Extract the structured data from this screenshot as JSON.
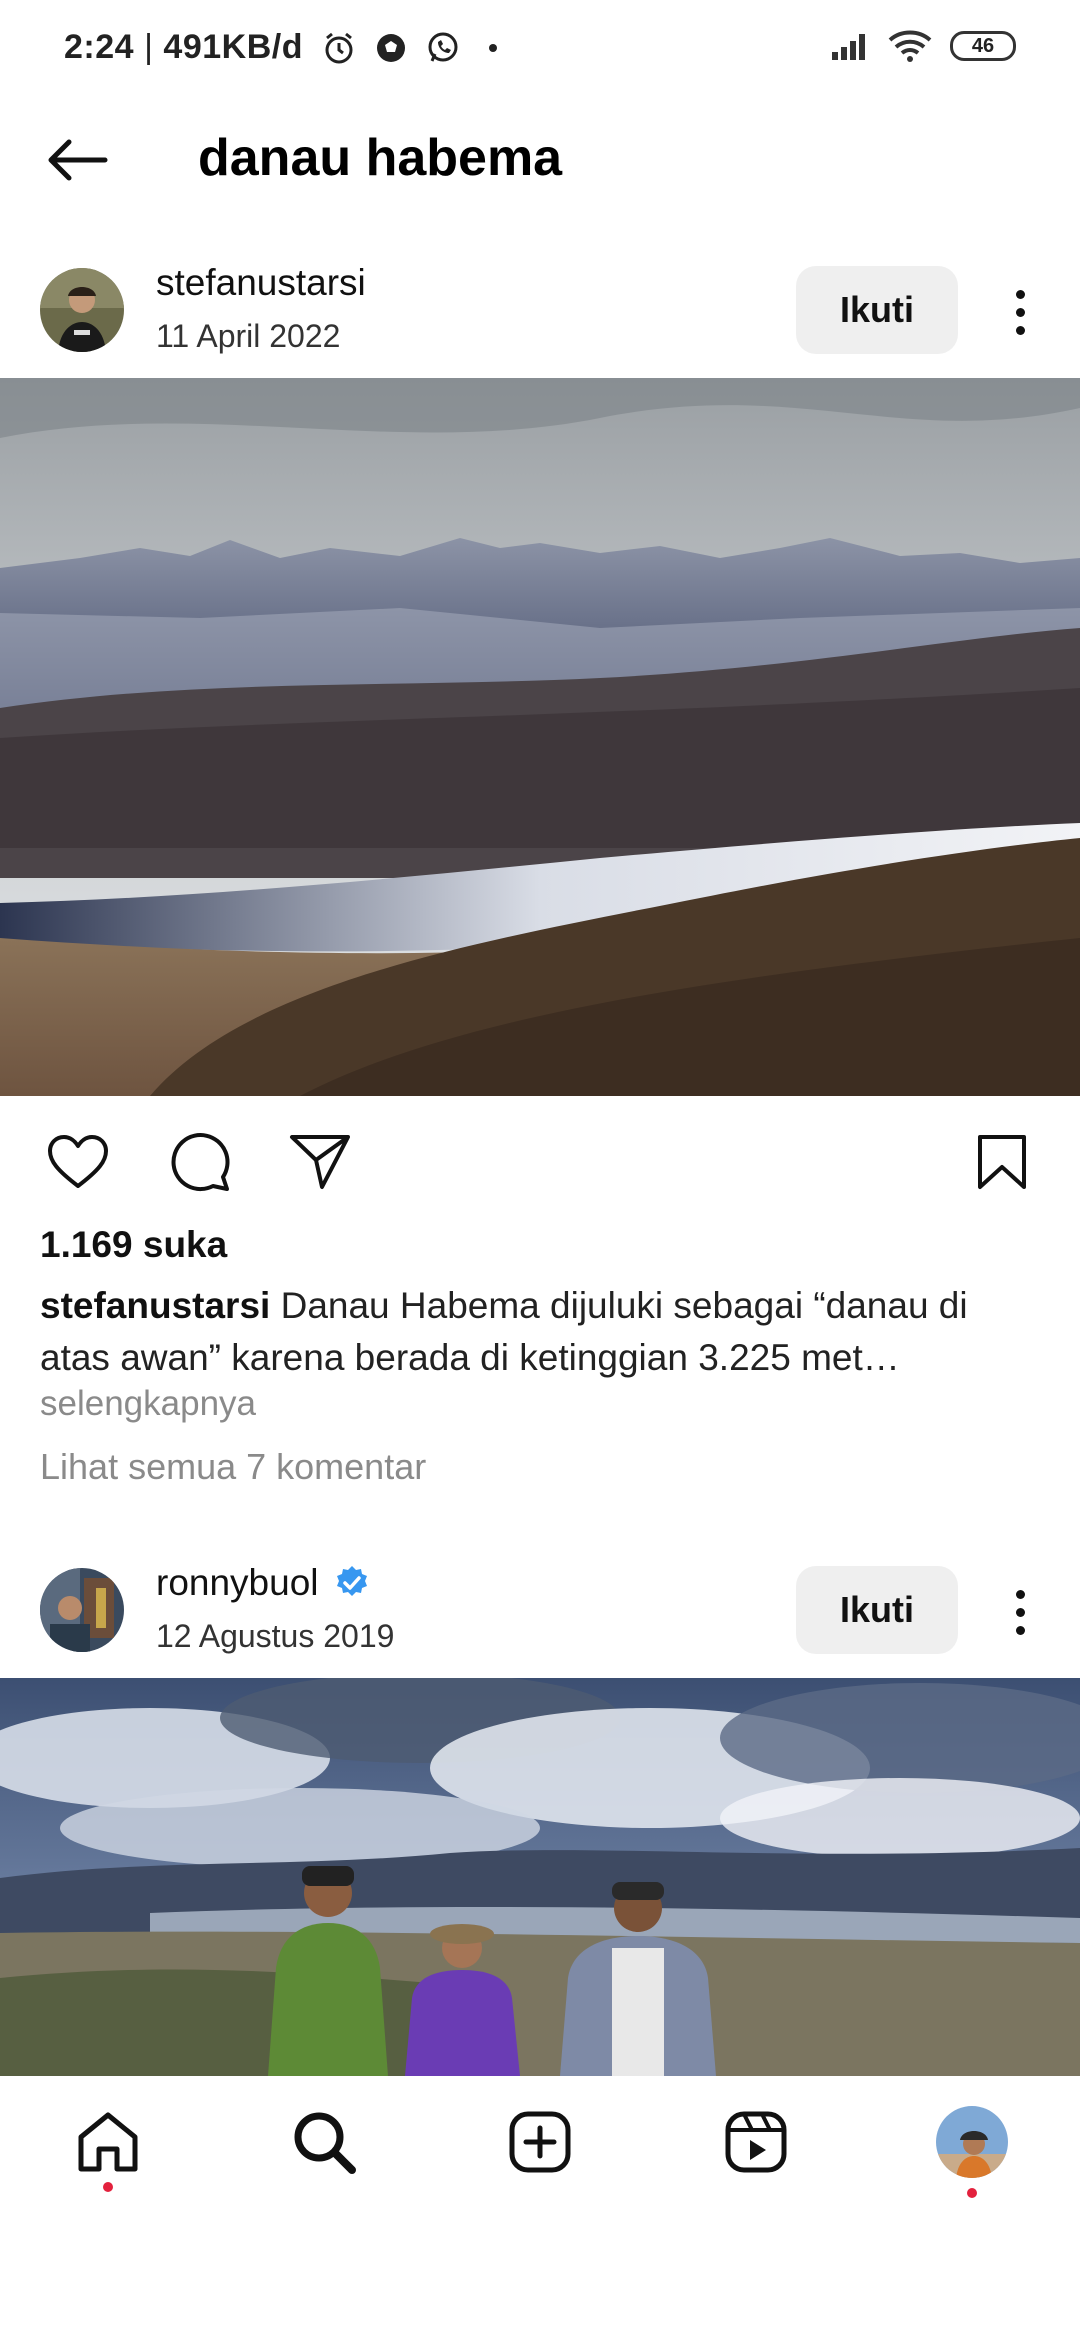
{
  "status_bar": {
    "time": "2:24",
    "separator": "|",
    "network_speed": "491KB/d",
    "battery": "46",
    "icons": [
      "alarm-icon",
      "soccer-ball-icon",
      "whatsapp-icon",
      "signal-icon",
      "wifi-icon",
      "battery-icon"
    ]
  },
  "header": {
    "title": "danau habema",
    "back_icon": "arrow-left-icon"
  },
  "posts": [
    {
      "username": "stefanustarsi",
      "date": "11 April 2022",
      "follow_label": "Ikuti",
      "verified": false,
      "likes": "1.169 suka",
      "caption_user": "stefanustarsi",
      "caption_text": " Danau Habema dijuluki sebagai “danau di atas awan” karena berada di ketinggian 3.225 met…",
      "more_label": "selengkapnya",
      "comments_label": "Lihat semua 7 komentar"
    },
    {
      "username": "ronnybuol",
      "date": "12 Agustus 2019",
      "follow_label": "Ikuti",
      "verified": true
    }
  ],
  "actions": [
    "heart-icon",
    "comment-icon",
    "share-icon",
    "bookmark-icon"
  ],
  "bottom_nav": [
    "home-icon",
    "search-icon",
    "create-icon",
    "reels-icon",
    "profile-avatar"
  ],
  "colors": {
    "accent_red": "#e3213d",
    "verified_blue": "#3797f0",
    "muted_text": "#8a8a8a",
    "button_bg": "#efefef"
  }
}
